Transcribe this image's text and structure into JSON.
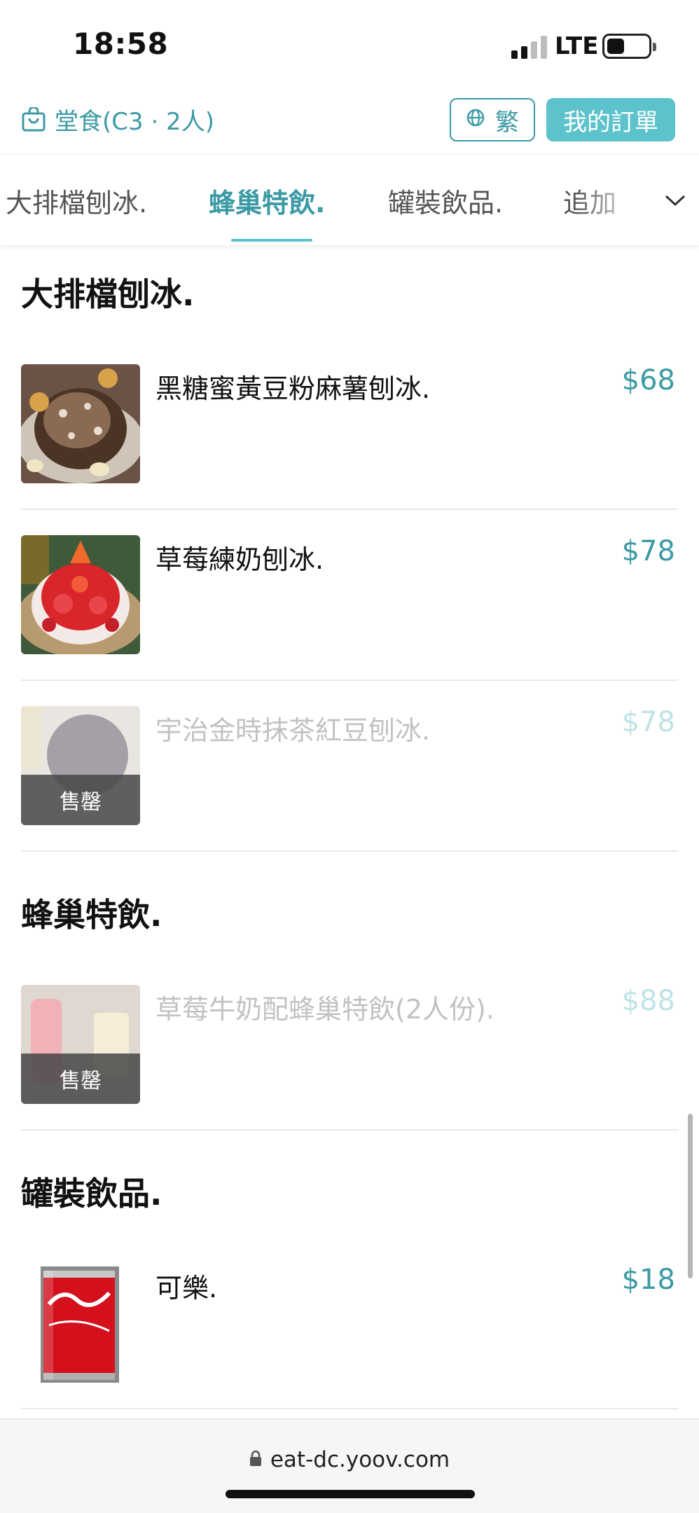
{
  "status_bar": {
    "time": "18:58",
    "network": "LTE"
  },
  "header": {
    "dine_in_label": "堂食(C3 · 2人)",
    "language_label": "繁",
    "my_orders_label": "我的訂單"
  },
  "tabs": [
    {
      "label": "大排檔刨冰."
    },
    {
      "label": "蜂巢特飲."
    },
    {
      "label": "罐裝飲品."
    },
    {
      "label": "追加"
    }
  ],
  "active_tab": "蜂巢特飲.",
  "sections": [
    {
      "title": "大排檔刨冰.",
      "items": [
        {
          "name": "黑糖蜜黃豆粉麻薯刨冰.",
          "price": "$68",
          "sold_out": false
        },
        {
          "name": "草莓練奶刨冰.",
          "price": "$78",
          "sold_out": false
        },
        {
          "name": "宇治金時抹茶紅豆刨冰.",
          "price": "$78",
          "sold_out": true,
          "badge": "售罄"
        }
      ]
    },
    {
      "title": "蜂巢特飲.",
      "items": [
        {
          "name": "草莓牛奶配蜂巢特飲(2人份).",
          "price": "$88",
          "sold_out": true,
          "badge": "售罄"
        }
      ]
    },
    {
      "title": "罐裝飲品.",
      "items": [
        {
          "name": "可樂.",
          "price": "$18",
          "sold_out": false
        }
      ]
    }
  ],
  "browser": {
    "url": "eat-dc.yoov.com"
  },
  "colors": {
    "accent": "#3c9aa5",
    "accent_light": "#5cc2cb",
    "sold_out_band": "#464646"
  }
}
